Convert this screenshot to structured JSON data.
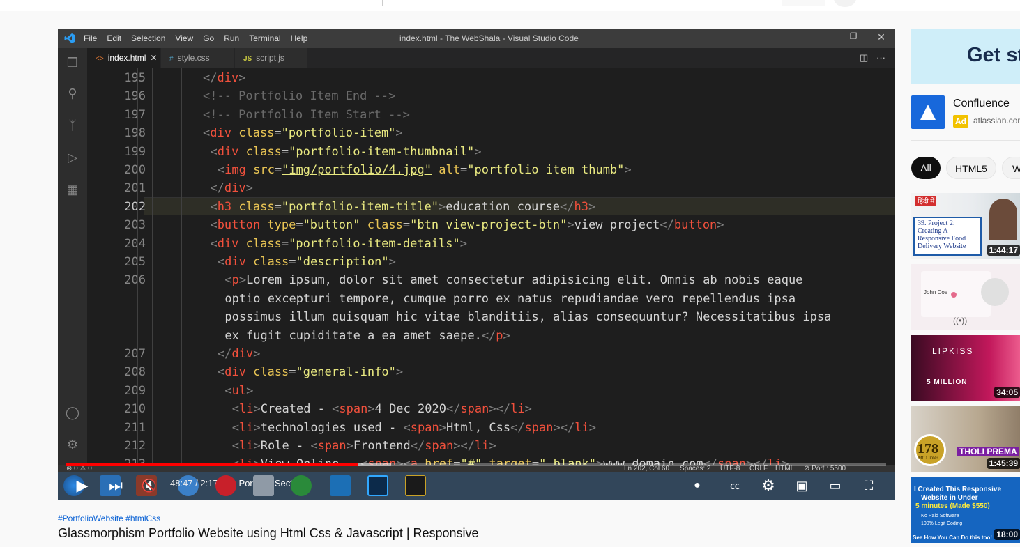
{
  "vscode": {
    "menu": [
      "File",
      "Edit",
      "Selection",
      "View",
      "Go",
      "Run",
      "Terminal",
      "Help"
    ],
    "window_title": "index.html - The WebShala - Visual Studio Code",
    "tabs": [
      {
        "icon": "<>",
        "label": "index.html",
        "active": true
      },
      {
        "icon": "#",
        "label": "style.css",
        "active": false
      },
      {
        "icon": "JS",
        "label": "script.js",
        "active": false
      }
    ],
    "line_numbers": [
      "195",
      "196",
      "197",
      "198",
      "199",
      "200",
      "201",
      "202",
      "203",
      "204",
      "205",
      "206",
      "",
      "",
      "",
      "207",
      "208",
      "209",
      "210",
      "211",
      "212",
      "213"
    ],
    "code_lines": [
      "</div>",
      "<!-- Portfolio Item End -->",
      "<!-- Portfolio Item Start -->",
      "<div class=\"portfolio-item\">",
      "<div class=\"portfolio-item-thumbnail\">",
      "<img src=\"img/portfolio/4.jpg\" alt=\"portfolio item thumb\">",
      "</div>",
      "<h3 class=\"portfolio-item-title\">education course</h3>",
      "<button type=\"button\" class=\"btn view-project-btn\">view project</button>",
      "<div class=\"portfolio-item-details\">",
      "<div class=\"description\">",
      "<p>Lorem ipsum, dolor sit amet consectetur adipisicing elit. Omnis ab nobis eaque",
      "optio excepturi tempore, cumque porro ex natus repudiandae vero repellendus ipsa",
      "possimus illum quisquam hic vitae blanditiis, alias consequuntur? Necessitatibus ipsa",
      "ex fugit cupiditate a ea amet saepe.</p>",
      "</div>",
      "<div class=\"general-info\">",
      "<ul>",
      "<li>Created - <span>4 Dec 2020</span></li>",
      "<li>technologies used - <span>Html, Css</span></li>",
      "<li>Role - <span>Frontend</span></li>",
      "<li>View Online - <span><a href=\"#\" target=\"_blank\">www.domain.com</span></li>"
    ],
    "active_line": "202",
    "status": {
      "problems": "⊗ 0 ⚠ 0",
      "position": "Ln 202, Col 60",
      "spaces": "Spaces: 2",
      "encoding": "UTF-8",
      "eol": "CRLF",
      "language": "HTML",
      "port": "⊘ Port : 5500"
    }
  },
  "player": {
    "time": "48:47 / 2:17:04",
    "chapter": "Portfolio Section",
    "progress": 0.356,
    "colors": {
      "progress": "#ff0000"
    }
  },
  "video": {
    "hashtags": "#PortfolioWebsite #htmlCss",
    "title": "Glassmorphism Portfolio Website using Html Css & Javascript | Responsive"
  },
  "ad": {
    "banner_text": "Get st",
    "name": "Confluence",
    "badge": "Ad",
    "domain": "atlassian.com"
  },
  "chips": [
    "All",
    "HTML5",
    "W"
  ],
  "thumbnails": [
    {
      "duration": "1:44:17",
      "lines": [
        "हिंदी में",
        "39. Project 2:",
        "Creating A",
        "Responsive Food",
        "Delivery Website"
      ]
    },
    {
      "duration": "",
      "lines": [
        "John Doe",
        "((•))"
      ]
    },
    {
      "duration": "34:05",
      "lines": [
        "LIPKISS",
        "5 MILLION"
      ]
    },
    {
      "duration": "1:45:39",
      "lines": [
        "178",
        "MILLION+",
        "THOLI PREMA"
      ]
    },
    {
      "duration": "18:00",
      "lines": [
        "I Created This Responsive",
        "Website in Under",
        "5 minutes (Made $550)",
        "No Paid Software",
        "100% Legit Coding",
        "See How You Can Do this too!"
      ]
    }
  ]
}
